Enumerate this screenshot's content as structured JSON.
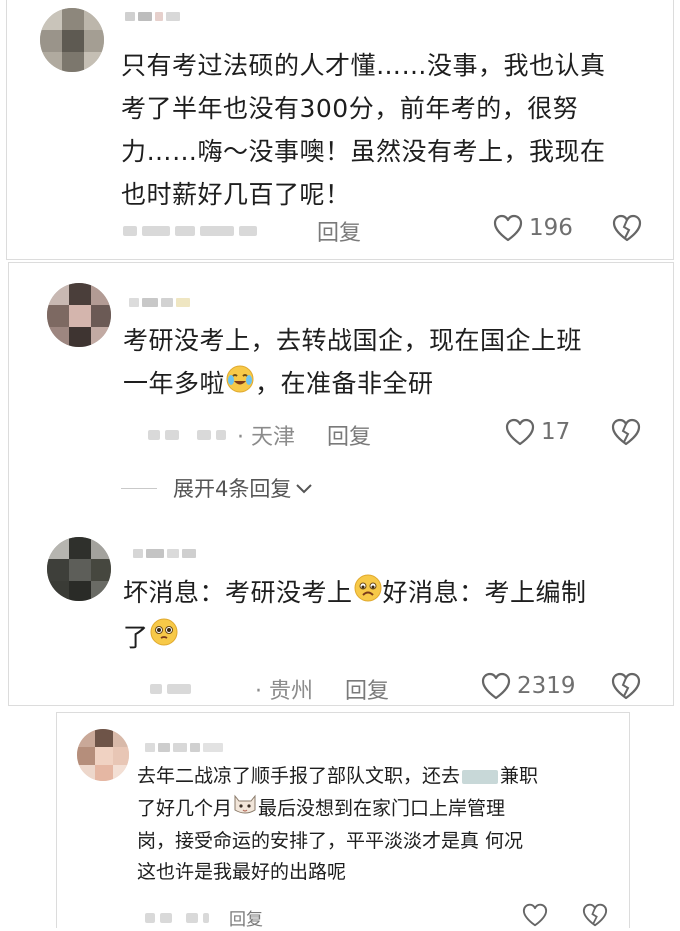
{
  "comments": [
    {
      "text_lines": [
        "只有考过法硕的人才懂……没事，我也认真",
        "考了半年也没有300分，前年考的，很努",
        "力……嗨～没事噢！虽然没有考上，我现在",
        "也时薪好几百了呢！"
      ],
      "reply_label": "回复",
      "like_count": "196"
    },
    {
      "text_line1": "考研没考上，去转战国企，现在国企上班",
      "text_line2_a": "一年多啦",
      "text_line2_b": "，在准备非全研",
      "location": "· 天津",
      "reply_label": "回复",
      "like_count": "17",
      "expand_label": "展开4条回复"
    },
    {
      "text_a": "坏消息：考研没考上",
      "text_b": "好消息：考上编制",
      "text_c": "了",
      "location": "· 贵州",
      "reply_label": "回复",
      "like_count": "2319"
    },
    {
      "text_line1_a": "去年二战凉了顺手报了部队文职，还去",
      "text_line1_b": "兼职",
      "text_line2_a": "了好几个月",
      "text_line2_b": "最后没想到在家门口上岸管理",
      "text_line3": "岗，接受命运的安排了，平平淡淡才是真 何况",
      "text_line4": "这也许是我最好的出路呢",
      "reply_label": "回复"
    }
  ],
  "icons": {
    "like": "heart-outline-icon",
    "dislike": "broken-heart-icon",
    "expand": "chevron-down-icon"
  },
  "colors": {
    "text": "#1e1e1e",
    "meta": "#8b8b8b",
    "border": "#dcdcdc"
  }
}
